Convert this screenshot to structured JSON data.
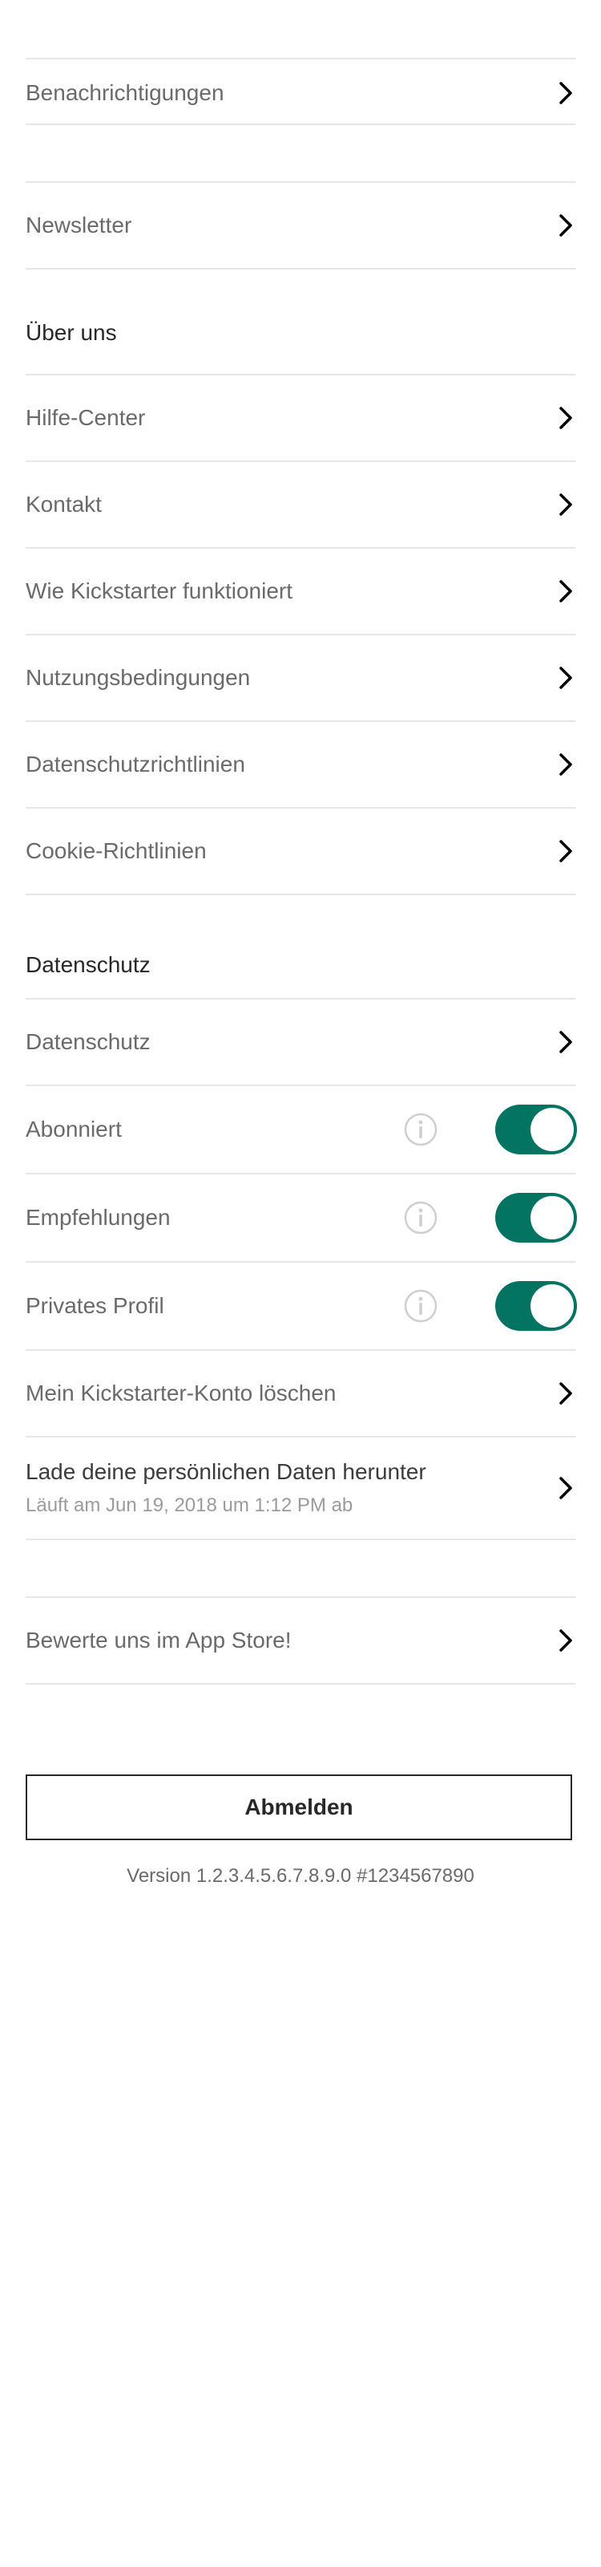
{
  "account": {
    "notifications": "Benachrichtigungen",
    "newsletter": "Newsletter"
  },
  "about": {
    "header": "Über uns",
    "items": [
      "Hilfe-Center",
      "Kontakt",
      "Wie Kickstarter funktioniert",
      "Nutzungsbedingungen",
      "Datenschutzrichtlinien",
      "Cookie-Richtlinien"
    ]
  },
  "privacy": {
    "header": "Datenschutz",
    "privacy_item": "Datenschutz",
    "toggles": [
      {
        "label": "Abonniert",
        "on": true
      },
      {
        "label": "Empfehlungen",
        "on": true
      },
      {
        "label": "Privates Profil",
        "on": true
      }
    ],
    "delete_account": "Mein Kickstarter-Konto löschen",
    "download_data": {
      "title": "Lade deine persönlichen Daten herunter",
      "subtitle": "Läuft am Jun 19, 2018 um 1:12 PM ab"
    }
  },
  "rate_app": "Bewerte uns im App Store!",
  "logout_label": "Abmelden",
  "version": "Version 1.2.3.4.5.6.7.8.9.0 #1234567890",
  "colors": {
    "toggle_on": "#037362",
    "divider": "#e6e6e6",
    "text_primary": "#282828",
    "text_secondary": "#6a6a6a"
  },
  "icons": {
    "chevron": "chevron-right-icon",
    "info": "info-icon"
  }
}
